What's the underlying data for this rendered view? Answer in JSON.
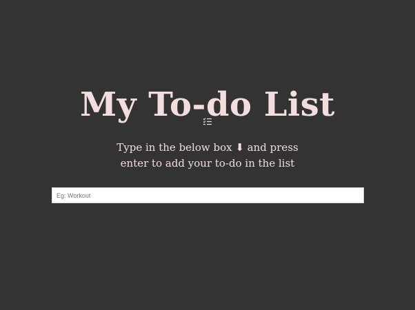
{
  "header": {
    "title": "My To-do List",
    "icon": "checklist-icon"
  },
  "instructions": {
    "line1_before_arrow": "Type in the below box ",
    "arrow_glyph": "⬇",
    "line1_after_arrow": " and press",
    "line2": "enter to add your to-do in the list"
  },
  "todo_input": {
    "placeholder": "Eg: Workout",
    "value": ""
  },
  "colors": {
    "background": "#333333",
    "text": "#f2dede"
  }
}
